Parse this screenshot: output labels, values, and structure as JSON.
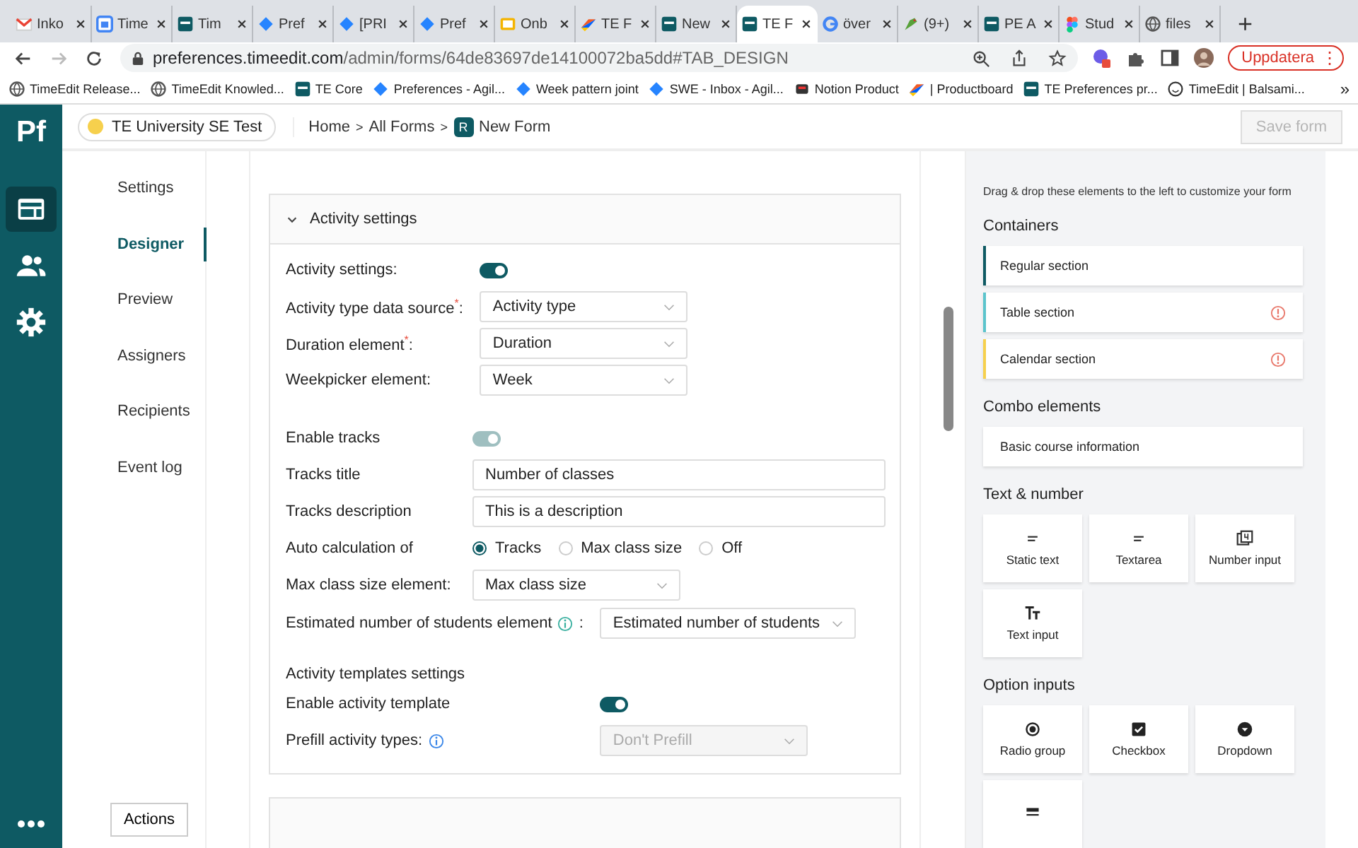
{
  "browser": {
    "tabs": [
      {
        "title": "Inko",
        "kind": "mail",
        "selected": false
      },
      {
        "title": "Time",
        "kind": "calendar",
        "selected": false
      },
      {
        "title": "Tim",
        "kind": "te",
        "selected": false
      },
      {
        "title": "Pref",
        "kind": "diamond",
        "selected": false
      },
      {
        "title": "[PRI",
        "kind": "diamond",
        "selected": false
      },
      {
        "title": "Pref",
        "kind": "diamond",
        "selected": false
      },
      {
        "title": "Onb",
        "kind": "slides",
        "selected": false
      },
      {
        "title": "TE F",
        "kind": "pb",
        "selected": false
      },
      {
        "title": "New",
        "kind": "te",
        "selected": false
      },
      {
        "title": "TE F",
        "kind": "te",
        "selected": true
      },
      {
        "title": "över",
        "kind": "google",
        "selected": false
      },
      {
        "title": "(9+)",
        "kind": "bird",
        "selected": false
      },
      {
        "title": "PE A",
        "kind": "te",
        "selected": false
      },
      {
        "title": "Stud",
        "kind": "figma",
        "selected": false
      },
      {
        "title": "files",
        "kind": "globe",
        "selected": false
      }
    ],
    "new_tab": "+",
    "address": {
      "host": "preferences.timeedit.com",
      "path": "/admin/forms/64de83697de14100072ba5dd#TAB_DESIGN"
    },
    "update_button": "Uppdatera",
    "menu_button": "⋮",
    "bookmarks": [
      {
        "label": "TimeEdit Release...",
        "kind": "globe"
      },
      {
        "label": "TimeEdit Knowled...",
        "kind": "globe"
      },
      {
        "label": "TE Core",
        "kind": "te"
      },
      {
        "label": "Preferences - Agil...",
        "kind": "diamond"
      },
      {
        "label": "Week pattern joint",
        "kind": "diamond"
      },
      {
        "label": "SWE - Inbox - Agil...",
        "kind": "diamond"
      },
      {
        "label": "Notion Product",
        "kind": "train"
      },
      {
        "label": "| Productboard",
        "kind": "pb"
      },
      {
        "label": "TE Preferences pr...",
        "kind": "te"
      },
      {
        "label": "TimeEdit | Balsami...",
        "kind": "smiley"
      }
    ],
    "more": "»"
  },
  "app": {
    "logo": "Pf",
    "rail": [
      {
        "kind": "form",
        "selected": true
      },
      {
        "kind": "people",
        "selected": false
      },
      {
        "kind": "gear",
        "selected": false
      }
    ],
    "org": "TE University SE Test",
    "breadcrumb": [
      "Home",
      ">",
      "All Forms",
      ">"
    ],
    "form_badge": "R",
    "form_name": "New Form",
    "save_button": {
      "label": "Save form",
      "disabled": true
    },
    "nav": [
      {
        "label": "Settings",
        "selected": false
      },
      {
        "label": "Designer",
        "selected": true
      },
      {
        "label": "Preview",
        "selected": false
      },
      {
        "label": "Assigners",
        "selected": false
      },
      {
        "label": "Recipients",
        "selected": false
      },
      {
        "label": "Event log",
        "selected": false
      }
    ],
    "actions_button": "Actions"
  },
  "section": {
    "title": "Activity settings",
    "expanded": true,
    "groups": [
      {
        "rows": [
          {
            "kind": "toggle",
            "label": "Activity settings:",
            "on": true,
            "disabled": false
          },
          {
            "kind": "select",
            "label": "Activity type data source$^{*}$:",
            "value": "Activity type",
            "disabled": false
          },
          {
            "kind": "select",
            "label": "Duration element$^{*}$:",
            "value": "Duration",
            "disabled": false
          },
          {
            "kind": "select",
            "label": "Weekpicker element:",
            "value": "Week",
            "disabled": false
          }
        ]
      },
      {
        "rows": [
          {
            "kind": "toggle",
            "label": "Enable tracks",
            "on": true,
            "disabled": true
          },
          {
            "kind": "input",
            "label": "Tracks title",
            "value": "Number of classes"
          },
          {
            "kind": "input",
            "label": "Tracks description",
            "value": "This is a description"
          },
          {
            "kind": "radio",
            "label": "Auto calculation of",
            "options": [
              {
                "label": "Tracks",
                "selected": true
              },
              {
                "label": "Max class size",
                "selected": false
              },
              {
                "label": "Off",
                "selected": false
              }
            ]
          },
          {
            "kind": "select",
            "label": "Max class size element:",
            "value": "Max class size",
            "disabled": false
          }
        ]
      },
      {
        "rows": [
          {
            "kind": "select",
            "label": "Estimated number of students element",
            "info": true,
            "color": "#3ab0a0",
            "suffix": ":",
            "value": "Estimated number of students",
            "disabled": false
          },
          {
            "kind": "heading",
            "label": "Activity templates settings"
          },
          {
            "kind": "toggle",
            "label": "Enable activity template",
            "on": true,
            "disabled": false
          },
          {
            "kind": "select",
            "label": "Prefill activity types:",
            "info": true,
            "color": "#3a86e8",
            "value": "Don't Prefill",
            "disabled": true
          }
        ]
      }
    ]
  },
  "palette": {
    "hint": "Drag & drop these elements to the left to customize your form",
    "containers": {
      "title": "Containers",
      "items": [
        {
          "label": "Regular section",
          "color": "#0e5a63",
          "warning": false
        },
        {
          "label": "Table section",
          "color": "#5bc4cc",
          "warning": true
        },
        {
          "label": "Calendar section",
          "color": "#f6d04d",
          "warning": true
        }
      ]
    },
    "combo": {
      "title": "Combo elements",
      "items": [
        {
          "label": "Basic course information"
        }
      ]
    },
    "text_number": {
      "title": "Text & number",
      "tiles": [
        {
          "label": "Static text",
          "kind": "lines"
        },
        {
          "label": "Textarea",
          "kind": "lines"
        },
        {
          "label": "Number input",
          "kind": "number"
        },
        {
          "label": "Text input",
          "kind": "text"
        }
      ]
    },
    "options": {
      "title": "Option inputs",
      "tiles": [
        {
          "label": "Radio group",
          "kind": "radio"
        },
        {
          "label": "Checkbox",
          "kind": "checkbox"
        },
        {
          "label": "Dropdown",
          "kind": "dropdown"
        },
        {
          "kind": "list"
        }
      ]
    }
  }
}
